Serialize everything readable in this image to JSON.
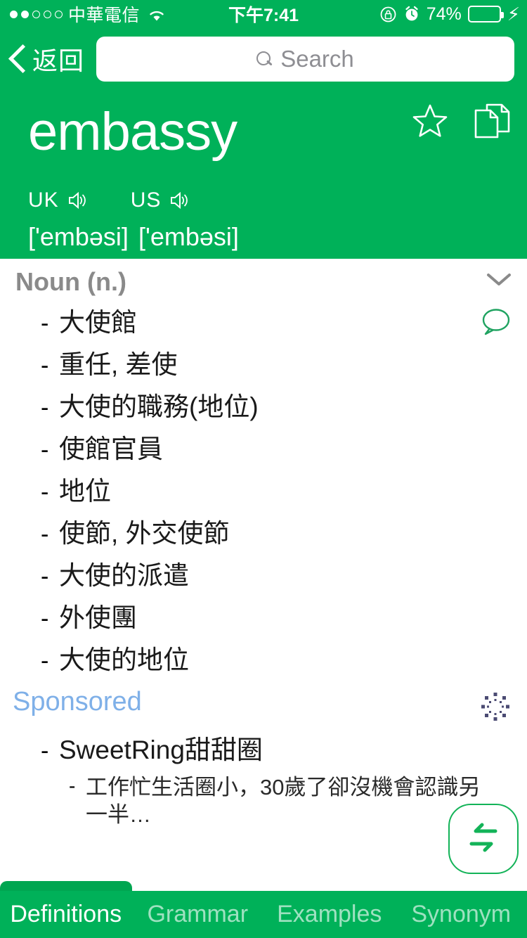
{
  "status_bar": {
    "signal_dots": [
      true,
      true,
      false,
      false,
      false
    ],
    "carrier": "中華電信",
    "wifi_icon": "wifi-icon",
    "time": "下午7:41",
    "rotation_lock_icon": "rotation-lock-icon",
    "alarm_icon": "alarm-clock-icon",
    "battery_percent": "74%",
    "battery_level": 74,
    "charging_icon": "lightning-bolt-icon"
  },
  "nav_bar": {
    "back_label": "返回",
    "back_icon": "chevron-left-icon",
    "search": {
      "icon": "search-icon",
      "placeholder": "Search",
      "value": ""
    }
  },
  "word_header": {
    "headword": "embassy",
    "favorite_icon": "star-outline-icon",
    "copy_icon": "copy-pages-icon",
    "pronunciations": [
      {
        "region": "UK",
        "ipa": "['embəsi]",
        "speaker_icon": "speaker-icon"
      },
      {
        "region": "US",
        "ipa": "['embəsi]",
        "speaker_icon": "speaker-icon"
      }
    ]
  },
  "definitions_section": {
    "part_of_speech": "Noun (n.)",
    "collapse_icon": "chevron-down-icon",
    "note_icon": "speech-bubble-icon",
    "items": [
      "大使館",
      "重任, 差使",
      "大使的職務(地位)",
      "使館官員",
      "地位",
      "使節, 外交使節",
      "大使的派遣",
      "外使團",
      "大使的地位"
    ]
  },
  "sponsored": {
    "label": "Sponsored",
    "spinner_icon": "loading-spinner-icon",
    "ad_title": "SweetRing甜甜圈",
    "ad_description": "工作忙生活圈小，30歲了卻沒機會認識另一半…"
  },
  "floating_button": {
    "icon": "swap-arrows-icon",
    "name": "swap-language-button"
  },
  "tab_bar": {
    "tabs": [
      {
        "label": "Definitions",
        "active": true
      },
      {
        "label": "Grammar",
        "active": false
      },
      {
        "label": "Examples",
        "active": false
      },
      {
        "label": "Synonym",
        "active": false
      }
    ]
  },
  "colors": {
    "brand_green": "#00B159",
    "tab_indicator_green": "#00A651",
    "sponsored_blue": "#7fb0e8",
    "pos_gray": "#8a8a8a"
  }
}
